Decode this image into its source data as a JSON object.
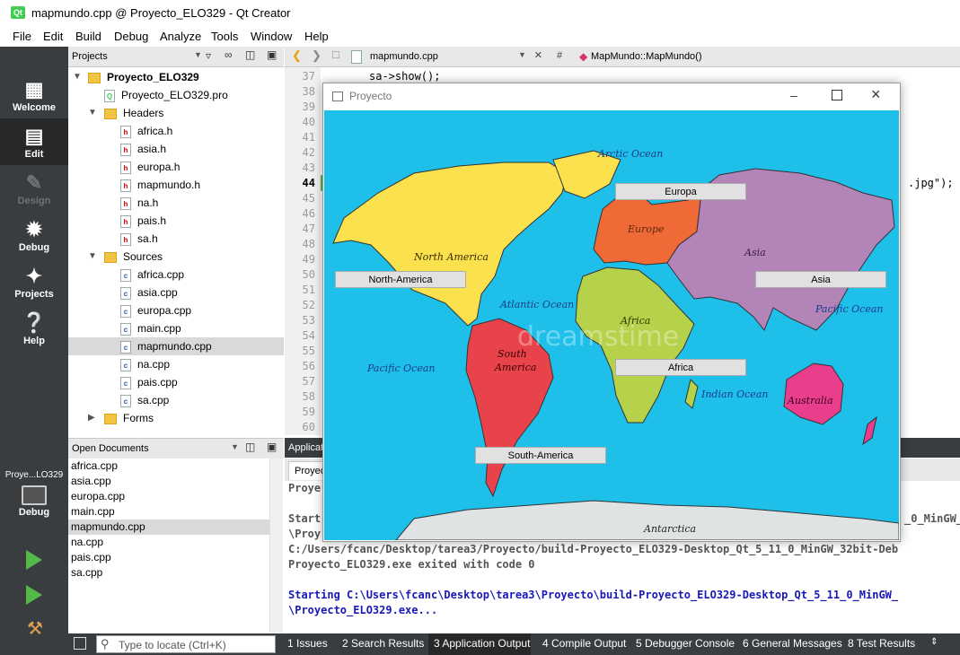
{
  "window": {
    "title": "mapmundo.cpp @ Proyecto_ELO329 - Qt Creator",
    "app_icon_text": "Qt"
  },
  "menu": [
    "File",
    "Edit",
    "Build",
    "Debug",
    "Analyze",
    "Tools",
    "Window",
    "Help"
  ],
  "modes": [
    {
      "label": "Welcome",
      "icon": "grid-icon"
    },
    {
      "label": "Edit",
      "icon": "document-icon"
    },
    {
      "label": "Design",
      "icon": "pencil-icon"
    },
    {
      "label": "Debug",
      "icon": "bug-icon"
    },
    {
      "label": "Projects",
      "icon": "wrench-icon"
    },
    {
      "label": "Help",
      "icon": "question-icon"
    }
  ],
  "kit": {
    "name": "Proye...LO329",
    "mode_label": "Debug"
  },
  "projects_pane": {
    "title": "Projects"
  },
  "tree": {
    "project": "Proyecto_ELO329",
    "pro_file": "Proyecto_ELO329.pro",
    "headers_label": "Headers",
    "headers": [
      "africa.h",
      "asia.h",
      "europa.h",
      "mapmundo.h",
      "na.h",
      "pais.h",
      "sa.h"
    ],
    "sources_label": "Sources",
    "sources": [
      "africa.cpp",
      "asia.cpp",
      "europa.cpp",
      "main.cpp",
      "mapmundo.cpp",
      "na.cpp",
      "pais.cpp",
      "sa.cpp"
    ],
    "forms_label": "Forms",
    "selected": "mapmundo.cpp"
  },
  "open_documents": {
    "title": "Open Documents",
    "items": [
      "africa.cpp",
      "asia.cpp",
      "europa.cpp",
      "main.cpp",
      "mapmundo.cpp",
      "na.cpp",
      "pais.cpp",
      "sa.cpp"
    ],
    "selected": "mapmundo.cpp"
  },
  "editor": {
    "file": "mapmundo.cpp",
    "hash": "#",
    "symbol": "MapMundo::MapMundo()",
    "line_numbers": [
      "37",
      "38",
      "39",
      "40",
      "41",
      "42",
      "43",
      "44",
      "45",
      "46",
      "47",
      "48",
      "49",
      "50",
      "51",
      "52",
      "53",
      "54",
      "55",
      "56",
      "57",
      "58",
      "59",
      "60"
    ],
    "current_line": "44",
    "code_line_37": "sa->show();",
    "code_line_44_tail": ".jpg\");"
  },
  "output_pane": {
    "header_label": "Applicat",
    "tab_label": "Proyec",
    "line1": "Proye",
    "line2": "Start",
    "line2_tail": "_0_MinGW_",
    "line3": "\\Proy",
    "line4": "C:/Users/fcanc/Desktop/tarea3/Proyecto/build-Proyecto_ELO329-Desktop_Qt_5_11_0_MinGW_32bit-Deb",
    "line5": "Proyecto_ELO329.exe exited with code 0",
    "line6": "Starting C:\\Users\\fcanc\\Desktop\\tarea3\\Proyecto\\build-Proyecto_ELO329-Desktop_Qt_5_11_0_MinGW_",
    "line7": "\\Proyecto_ELO329.exe..."
  },
  "statusbar": {
    "locate_placeholder": "Type to locate (Ctrl+K)",
    "tabs": [
      "1  Issues",
      "2  Search Results",
      "3  Application Output",
      "4  Compile Output",
      "5  Debugger Console",
      "6  General Messages",
      "8  Test Results"
    ]
  },
  "app_window": {
    "title": "Proyecto",
    "buttons": {
      "europa": "Europa",
      "north_america": "North-America",
      "asia": "Asia",
      "africa": "Africa",
      "south_america": "South-America"
    },
    "map_labels": {
      "arctic": "Arctic Ocean",
      "europe": "Europe",
      "north_america": "North America",
      "atlantic": "Atlantic Ocean",
      "asia": "Asia",
      "pacific_right": "Pacific Ocean",
      "africa": "Africa",
      "south": "South",
      "america": "America",
      "pacific_left": "Pacific Ocean",
      "indian": "Indian Ocean",
      "australia": "Australia",
      "antarctica": "Antarctica",
      "watermark": "dreamstime"
    },
    "colors": {
      "ocean": "#1ec0ea",
      "north_america": "#fbe14e",
      "europe": "#ef6a36",
      "asia": "#b384b8",
      "africa": "#b5d24a",
      "south_america": "#e8434a",
      "australia": "#e83e8c",
      "antarctica": "#dfe3e4"
    }
  }
}
